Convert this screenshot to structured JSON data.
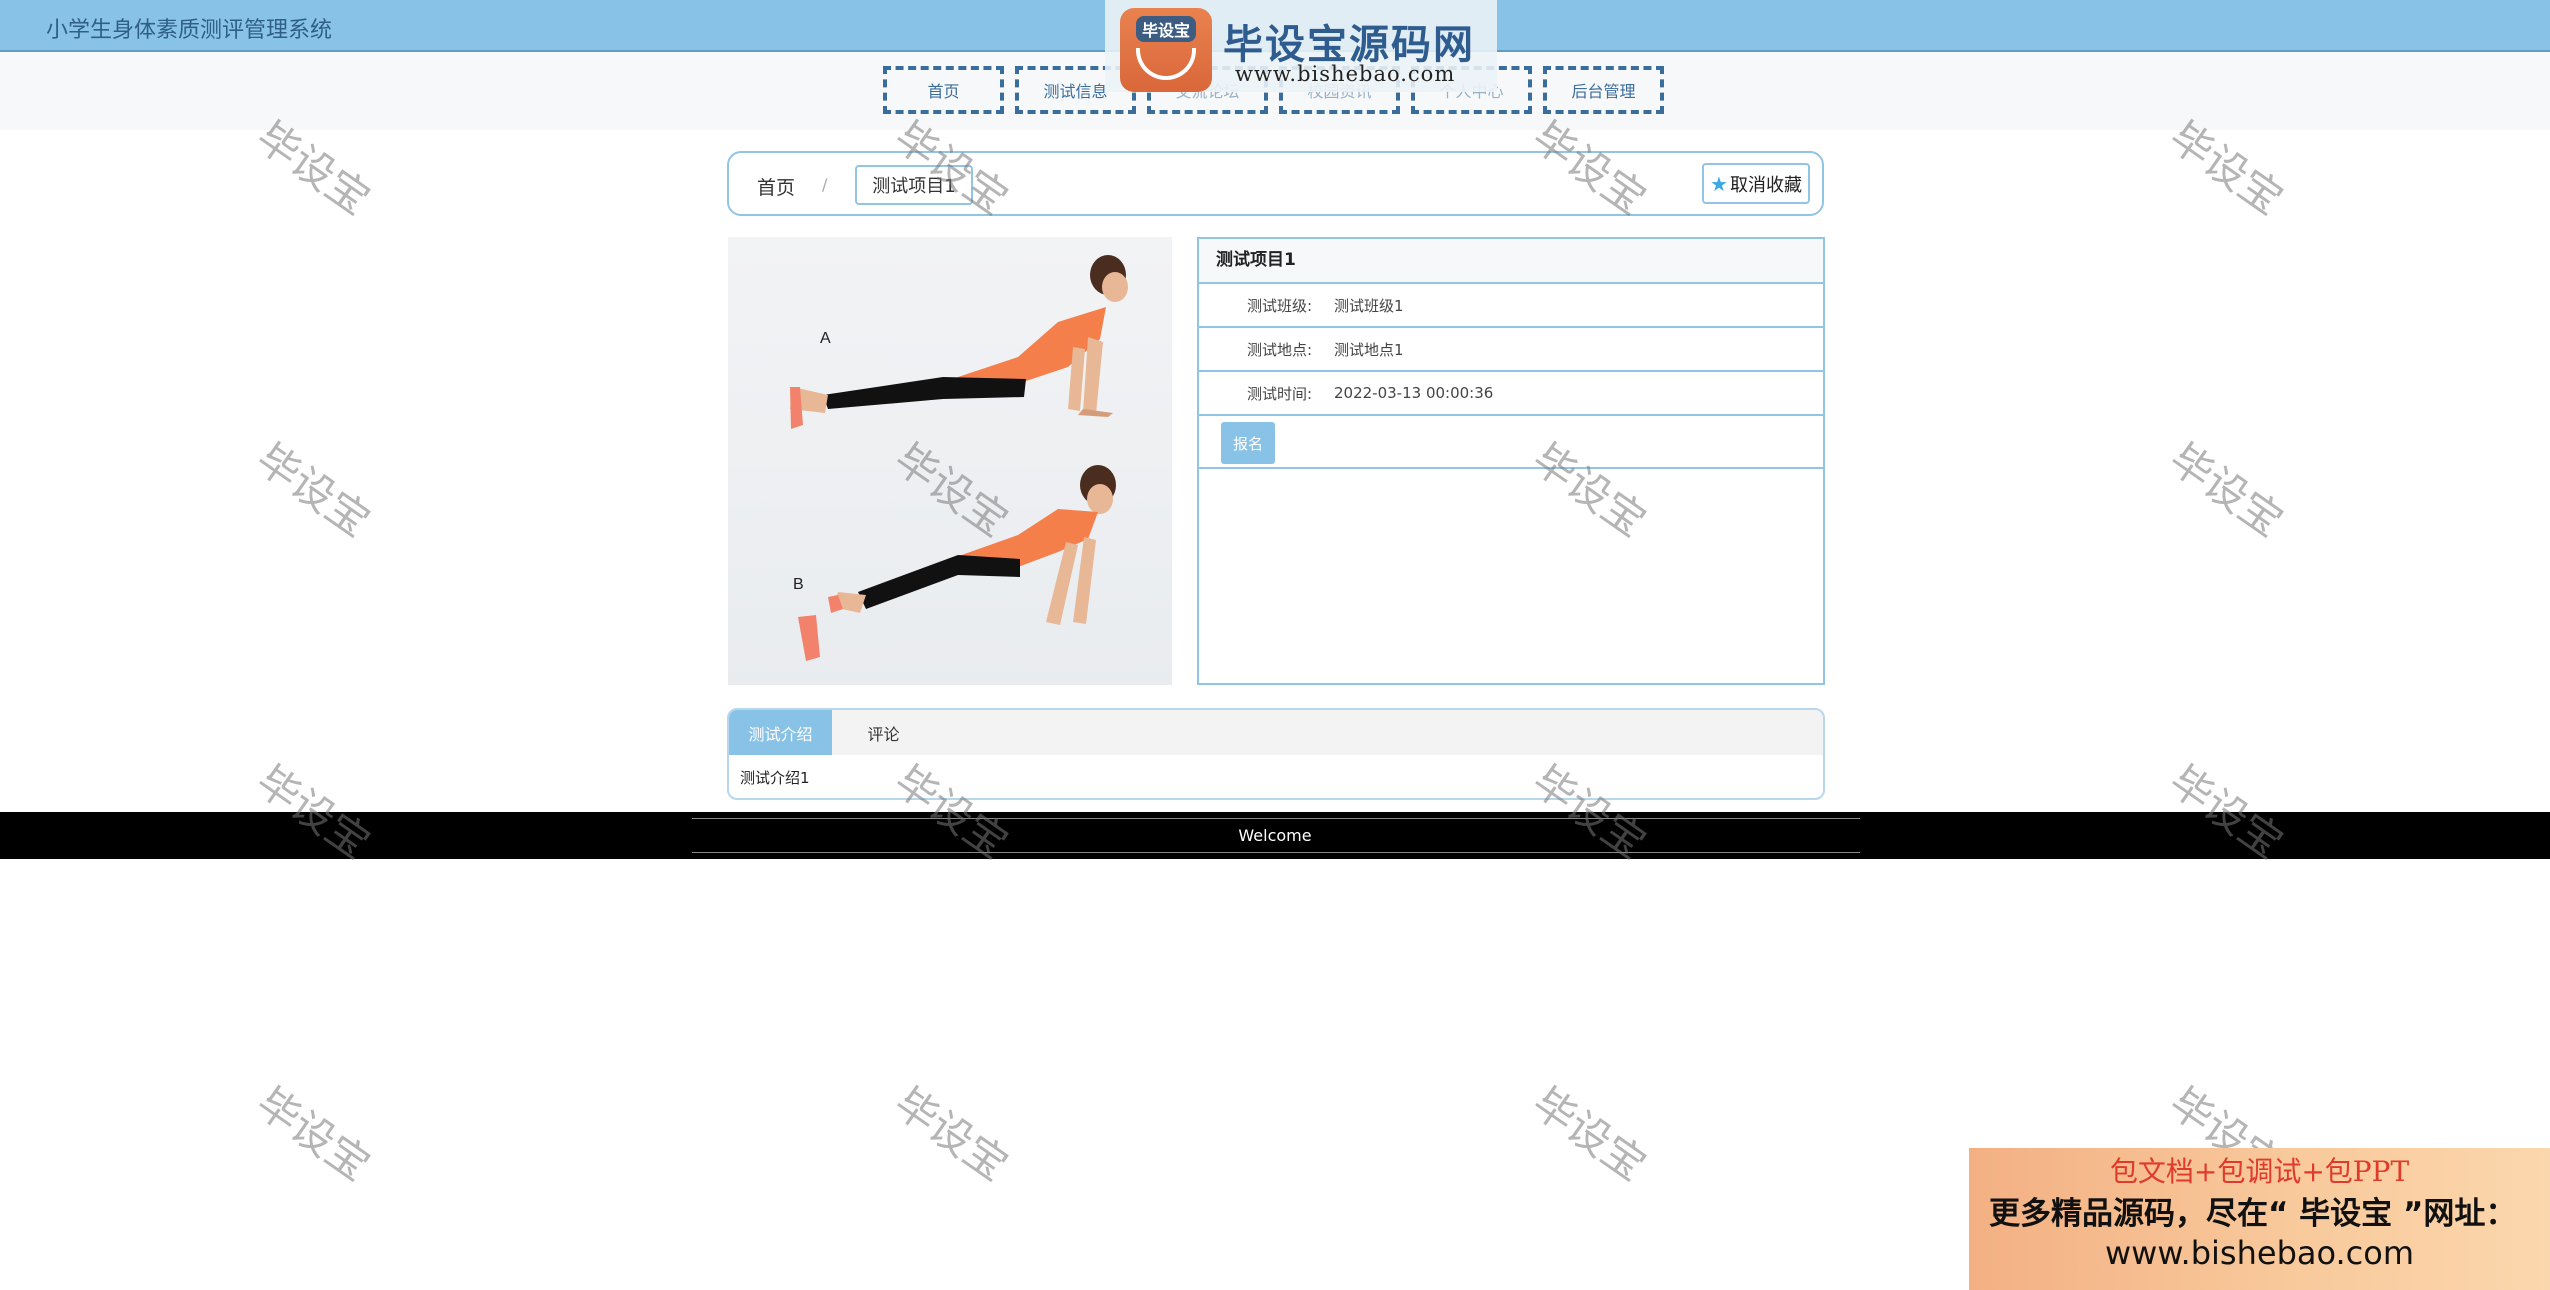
{
  "header": {
    "system_title": "小学生身体素质测评管理系统"
  },
  "nav": {
    "items": [
      {
        "label": "首页"
      },
      {
        "label": "测试信息"
      },
      {
        "label": "交流论坛"
      },
      {
        "label": "校园资讯"
      },
      {
        "label": "个人中心"
      },
      {
        "label": "后台管理"
      }
    ]
  },
  "brand": {
    "logo_text": "毕设宝",
    "name": "毕设宝源码网",
    "url": "www.bishebao.com"
  },
  "breadcrumb": {
    "home": "首页",
    "separator": "/",
    "current": "测试项目1",
    "favorite_label": "取消收藏"
  },
  "photo": {
    "label_a": "A",
    "label_b": "B"
  },
  "detail": {
    "title": "测试项目1",
    "fields": [
      {
        "key": "测试班级:",
        "value": "测试班级1"
      },
      {
        "key": "测试地点:",
        "value": "测试地点1"
      },
      {
        "key": "测试时间:",
        "value": "2022-03-13 00:00:36"
      }
    ],
    "signup_label": "报名"
  },
  "tabs": {
    "items": [
      {
        "label": "测试介绍"
      },
      {
        "label": "评论"
      }
    ],
    "active_content": "测试介绍1"
  },
  "footer": {
    "welcome": "Welcome"
  },
  "watermark": {
    "text": "毕设宝"
  },
  "ad": {
    "line1": "包文档+包调试+包PPT",
    "line2": "更多精品源码，尽在“ 毕设宝 ”网址：",
    "url": "www.bishebao.com"
  },
  "colors": {
    "accent": "#88c3e7",
    "nav_border": "#3b6d9c",
    "panel_border": "#92c4e4",
    "footer_bg": "#000000"
  }
}
